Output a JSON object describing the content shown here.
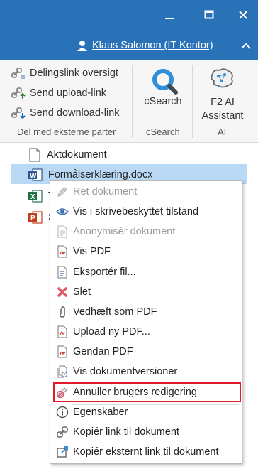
{
  "window": {
    "user_label": "Klaus Salomon (IT Kontor)"
  },
  "ribbon": {
    "share_group": {
      "items": [
        "Delingslink oversigt",
        "Send upload-link",
        "Send download-link"
      ],
      "label": "Del med eksterne parter"
    },
    "csearch_group": {
      "button_label": "cSearch",
      "label": "cSearch"
    },
    "ai_group": {
      "button_line1": "F2 AI",
      "button_line2": "Assistant",
      "label": "AI"
    }
  },
  "tree": {
    "items": [
      {
        "label": "Aktdokument"
      },
      {
        "label": "Formålserklæring.docx"
      },
      {
        "label": "T"
      },
      {
        "label": "S"
      }
    ]
  },
  "context_menu": {
    "items": [
      {
        "label": "Ret dokument",
        "icon": "pencil-icon",
        "enabled": false
      },
      {
        "label": "Vis i skrivebeskyttet tilstand",
        "icon": "eye-icon",
        "enabled": true
      },
      {
        "label": "Anonymisér dokument",
        "icon": "document-anonymize-icon",
        "enabled": false
      },
      {
        "label": "Vis PDF",
        "icon": "pdf-icon",
        "enabled": true
      },
      {
        "label": "Eksportér fil...",
        "icon": "export-file-icon",
        "enabled": true
      },
      {
        "label": "Slet",
        "icon": "delete-x-icon",
        "enabled": true
      },
      {
        "label": "Vedhæft som PDF",
        "icon": "paperclip-icon",
        "enabled": true
      },
      {
        "label": "Upload ny PDF...",
        "icon": "pdf-upload-icon",
        "enabled": true
      },
      {
        "label": "Gendan PDF",
        "icon": "pdf-restore-icon",
        "enabled": true
      },
      {
        "label": "Vis dokumentversioner",
        "icon": "document-versions-icon",
        "enabled": true
      },
      {
        "label": "Annuller brugers redigering",
        "icon": "cancel-edit-icon",
        "enabled": true,
        "highlighted": true
      },
      {
        "label": "Egenskaber",
        "icon": "info-icon",
        "enabled": true
      },
      {
        "label": "Kopiér link til dokument",
        "icon": "link-icon",
        "enabled": true
      },
      {
        "label": "Kopiér eksternt link til dokument",
        "icon": "external-link-icon",
        "enabled": true
      }
    ]
  },
  "colors": {
    "titlebar": "#2a72b8",
    "selection": "#b9d9f5",
    "highlight_border": "#e21b2c"
  }
}
